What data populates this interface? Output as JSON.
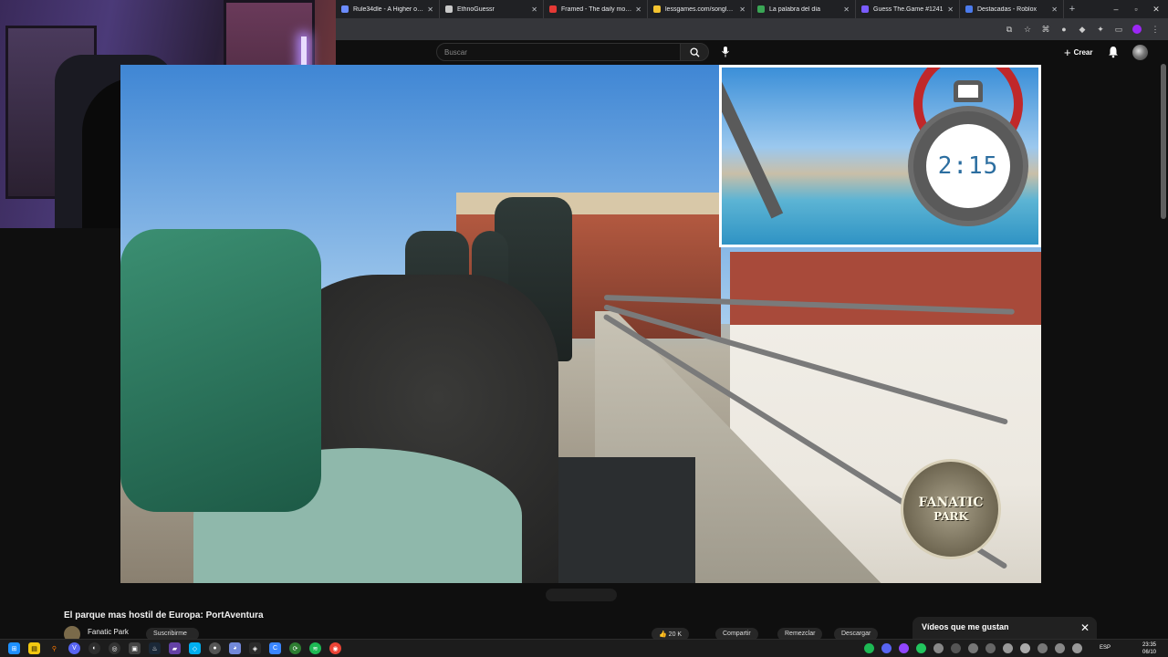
{
  "tabs": [
    {
      "label": "Rule34dle - A Higher or Lowe",
      "color": "#6b8cff"
    },
    {
      "label": "EthnoGuessr",
      "color": "#c9c9c9"
    },
    {
      "label": "Framed - The daily movie gue",
      "color": "#e53935"
    },
    {
      "label": "lessgames.com/songless",
      "color": "#f4c430"
    },
    {
      "label": "La palabra del día",
      "color": "#3aa655"
    },
    {
      "label": "Guess The.Game #1241",
      "color": "#7a5cff"
    },
    {
      "label": "Destacadas - Roblox",
      "color": "#4b7bec"
    }
  ],
  "youtube": {
    "search_placeholder": "Buscar",
    "create_label": "Crear"
  },
  "video": {
    "timer": "2:15",
    "logo_line1": "FANATIC",
    "logo_line2": "PARK",
    "title": "El parque mas hostil de Europa: PortAventura",
    "channel": "Fanatic Park",
    "subscribe_label": "Suscribirme",
    "likes": "20 K",
    "share_label": "Compartir",
    "remix_label": "Remezclar",
    "download_label": "Descargar"
  },
  "side_panel": {
    "title": "Vídeos que me gustan"
  },
  "taskbar": {
    "language": "ESP",
    "time": "23:35",
    "date": "06/10"
  },
  "colors": {
    "accent_red": "#c0282a",
    "timer_blue": "#2c6ea0"
  }
}
